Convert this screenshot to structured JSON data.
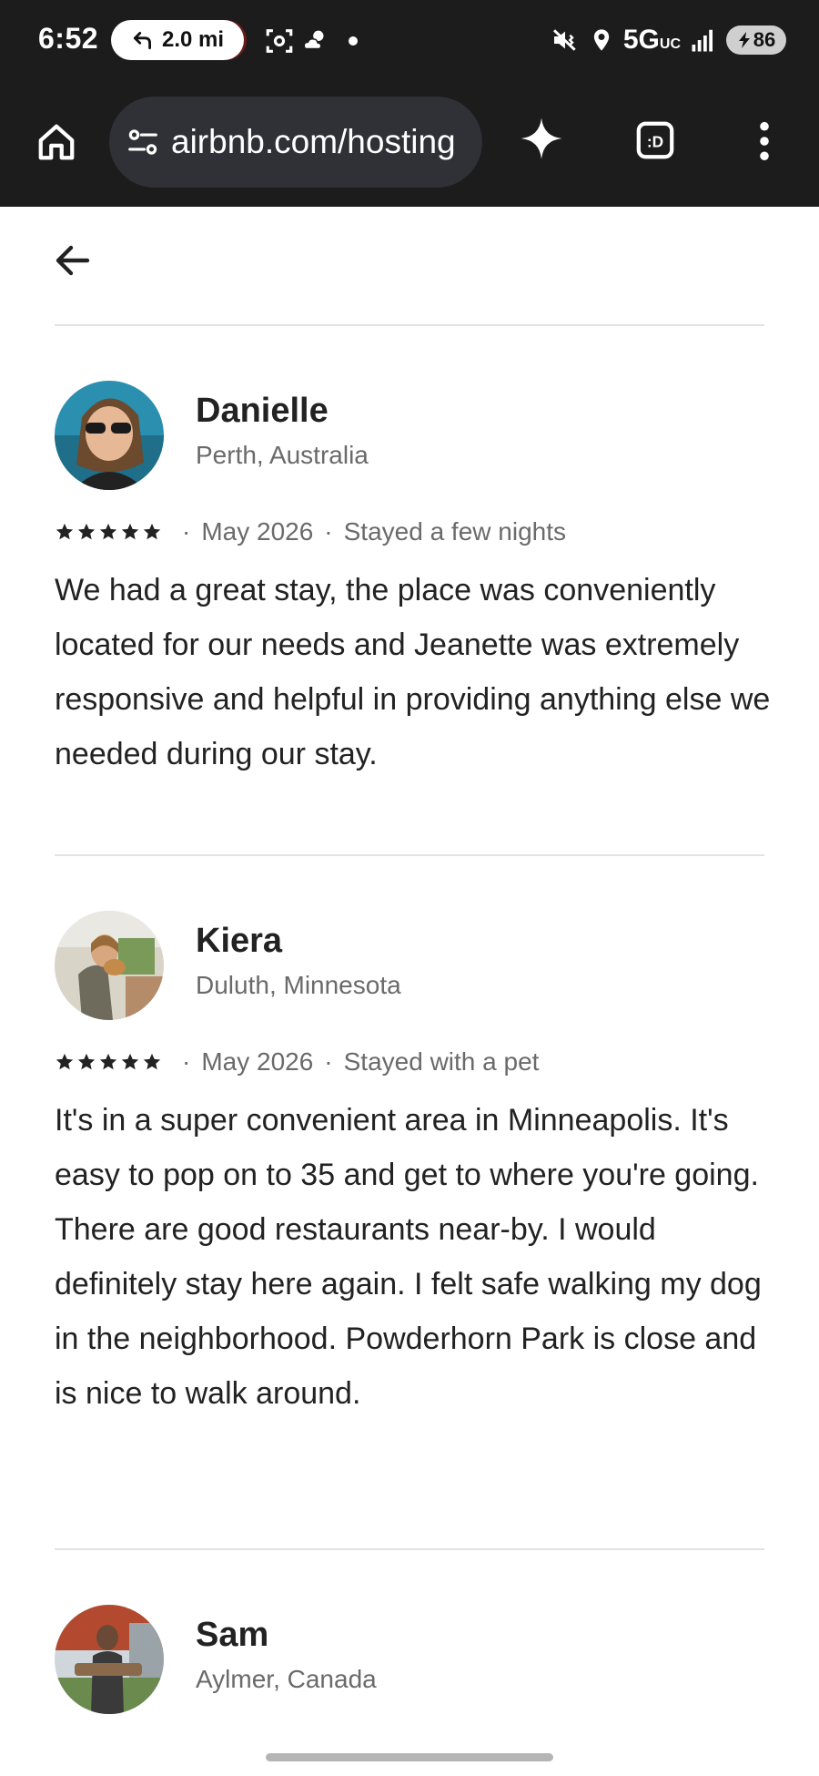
{
  "status_bar": {
    "time": "6:52",
    "nav_distance": "2.0 mi",
    "network": "5G",
    "network_sub": "UC",
    "battery": "86"
  },
  "browser": {
    "url": "airbnb.com/hosting"
  },
  "reviews": [
    {
      "name": "Danielle",
      "location": "Perth, Australia",
      "rating": 5,
      "date": "May 2026",
      "stay_type": "Stayed a few nights",
      "text": "We had a great stay, the place was conveniently located for our needs and Jeanette was extremely responsive and helpful in providing anything else we needed during our stay."
    },
    {
      "name": "Kiera",
      "location": "Duluth, Minnesota",
      "rating": 5,
      "date": "May 2026",
      "stay_type": "Stayed with a pet",
      "text": "It's in a super convenient area in Minneapolis. It's easy to pop on to 35 and get to where you're going. There are good restaurants near-by. I would definitely stay here again. I felt safe walking my dog in the neighborhood. Powderhorn Park is close and is nice to walk around."
    },
    {
      "name": "Sam",
      "location": "Aylmer, Canada"
    }
  ],
  "colors": {
    "chrome_bg": "#1c1c1c",
    "url_bar_bg": "#2f3136",
    "text_primary": "#222222",
    "text_secondary": "#6a6a6a"
  }
}
